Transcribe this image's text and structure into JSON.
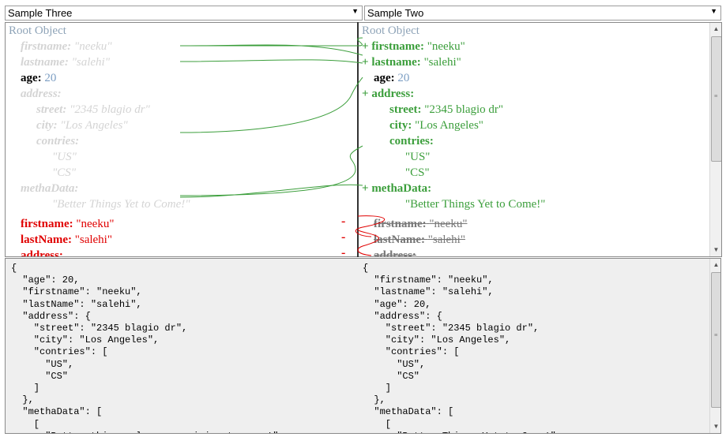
{
  "selects": {
    "left": "Sample Three",
    "right": "Sample Two"
  },
  "left_tree": {
    "root": "Root Object",
    "ghost": [
      {
        "key": "firstname:",
        "value": "\"neeku\""
      },
      {
        "key": "lastname:",
        "value": "\"salehi\""
      },
      {
        "key": "address:",
        "value": ""
      },
      {
        "key": "street:",
        "value": "\"2345 blagio dr\""
      },
      {
        "key": "city:",
        "value": "\"Los Angeles\""
      },
      {
        "key": "contries:",
        "value": ""
      },
      {
        "key": "",
        "value": "\"US\""
      },
      {
        "key": "",
        "value": "\"CS\""
      },
      {
        "key": "methaData:",
        "value": ""
      },
      {
        "key": "",
        "value": "\"Better Things Yet to Come!\""
      }
    ],
    "age": {
      "key": "age:",
      "value": "20"
    },
    "removed": [
      {
        "key": "firstname:",
        "value": "\"neeku\""
      },
      {
        "key": "lastName:",
        "value": "\"salehi\""
      },
      {
        "key": "address:",
        "value": ""
      }
    ],
    "minus": "-"
  },
  "right_tree": {
    "root": "Root Object",
    "plus": "+",
    "firstname": {
      "key": "firstname:",
      "value": "\"neeku\""
    },
    "lastname": {
      "key": "lastname:",
      "value": "\"salehi\""
    },
    "age": {
      "key": "age:",
      "value": "20"
    },
    "address": {
      "key": "address:"
    },
    "street": {
      "key": "street:",
      "value": "\"2345 blagio dr\""
    },
    "city": {
      "key": "city:",
      "value": "\"Los Angeles\""
    },
    "contries": {
      "key": "contries:"
    },
    "us": "\"US\"",
    "cs": "\"CS\"",
    "methaData": {
      "key": "methaData:"
    },
    "better": "\"Better Things Yet to Come!\"",
    "struck": [
      {
        "key": "firstname:",
        "value": "\"neeku\""
      },
      {
        "key": "lastName:",
        "value": "\"salehi\""
      },
      {
        "key": "address:",
        "value": ""
      }
    ]
  },
  "json_left": "{\n  \"age\": 20,\n  \"firstname\": \"neeku\",\n  \"lastName\": \"salehi\",\n  \"address\": {\n    \"street\": \"2345 blagio dr\",\n    \"city\": \"Los Angeles\",\n    \"contries\": [\n      \"US\",\n      \"CS\"\n    ]\n  },\n  \"methaData\": [\n    [\n      \"Better things always remaining to come!\"",
  "json_right": "{\n  \"firstname\": \"neeku\",\n  \"lastname\": \"salehi\",\n  \"age\": 20,\n  \"address\": {\n    \"street\": \"2345 blagio dr\",\n    \"city\": \"Los Angeles\",\n    \"contries\": [\n      \"US\",\n      \"CS\"\n    ]\n  },\n  \"methaData\": [\n    [\n      \"Better Things Yet to Come!\""
}
